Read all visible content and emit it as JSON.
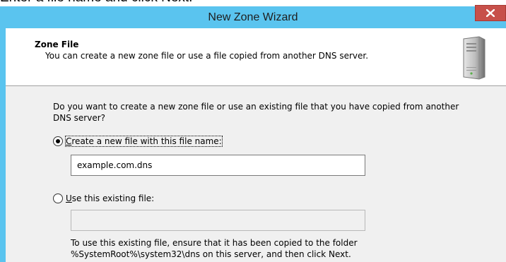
{
  "background_text": "Enter a file name and click Next.",
  "window": {
    "title": "New Zone Wizard",
    "close_glyph": "x"
  },
  "header": {
    "title": "Zone File",
    "subtitle": "You can create a new zone file or use a file copied from another DNS server."
  },
  "question": "Do you want to create a new zone file or use an existing file that you have copied from another DNS server?",
  "options": {
    "create": {
      "mnemonic": "C",
      "label_rest": "reate a new file with this file name:",
      "selected": true,
      "value": "example.com.dns"
    },
    "existing": {
      "mnemonic": "U",
      "label_rest": "se this existing file:",
      "selected": false,
      "value": ""
    }
  },
  "note": "To use this existing file, ensure that it has been copied to the folder %SystemRoot%\\system32\\dns on this server, and then click Next.",
  "colors": {
    "titlebar": "#5ac4ef",
    "close_button": "#c7504a",
    "client_background": "#f0f0f0"
  }
}
